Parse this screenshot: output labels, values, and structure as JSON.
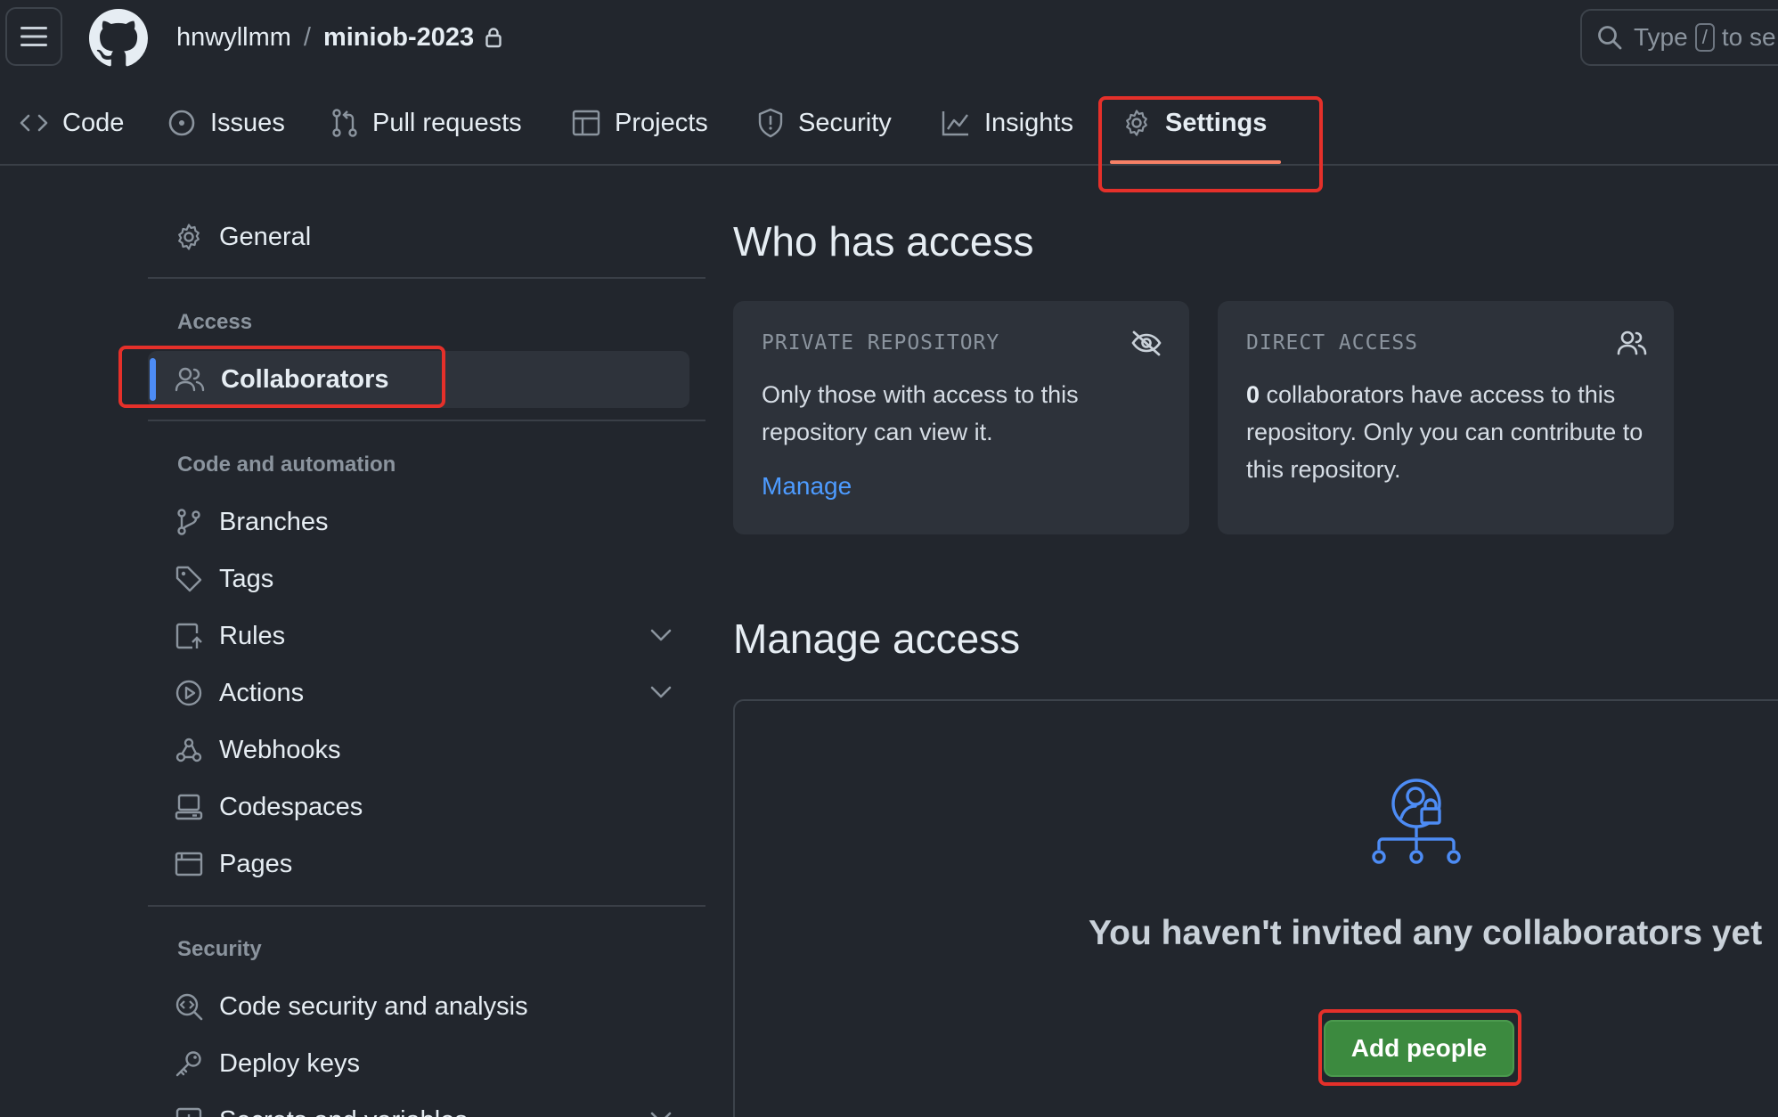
{
  "header": {
    "owner": "hnwyllmm",
    "separator": "/",
    "repo": "miniob-2023",
    "search": {
      "prefix": "Type",
      "key": "/",
      "suffix": "to se"
    },
    "tabs": [
      {
        "label": "Code",
        "icon": "code-icon"
      },
      {
        "label": "Issues",
        "icon": "issue-icon"
      },
      {
        "label": "Pull requests",
        "icon": "pull-request-icon"
      },
      {
        "label": "Projects",
        "icon": "table-icon"
      },
      {
        "label": "Security",
        "icon": "shield-icon"
      },
      {
        "label": "Insights",
        "icon": "graph-icon"
      },
      {
        "label": "Settings",
        "icon": "gear-icon",
        "active": true
      }
    ]
  },
  "sidebar": {
    "general": "General",
    "sections": [
      {
        "heading": "Access",
        "items": [
          {
            "label": "Collaborators",
            "icon": "people-icon",
            "selected": true
          }
        ]
      },
      {
        "heading": "Code and automation",
        "items": [
          {
            "label": "Branches",
            "icon": "branch-icon"
          },
          {
            "label": "Tags",
            "icon": "tag-icon"
          },
          {
            "label": "Rules",
            "icon": "rules-icon",
            "expandable": true
          },
          {
            "label": "Actions",
            "icon": "play-icon",
            "expandable": true
          },
          {
            "label": "Webhooks",
            "icon": "webhook-icon"
          },
          {
            "label": "Codespaces",
            "icon": "codespaces-icon"
          },
          {
            "label": "Pages",
            "icon": "browser-icon"
          }
        ]
      },
      {
        "heading": "Security",
        "items": [
          {
            "label": "Code security and analysis",
            "icon": "codescan-icon"
          },
          {
            "label": "Deploy keys",
            "icon": "key-icon"
          },
          {
            "label": "Secrets and variables",
            "icon": "secret-icon",
            "expandable": true
          }
        ]
      }
    ]
  },
  "main": {
    "who_title": "Who has access",
    "private_card": {
      "label": "PRIVATE REPOSITORY",
      "desc": "Only those with access to this repository can view it.",
      "link": "Manage",
      "icon": "eye-closed-icon"
    },
    "direct_card": {
      "label": "DIRECT ACCESS",
      "count": "0",
      "desc": " collaborators have access to this repository. Only you can contribute to this repository.",
      "icon": "people-icon"
    },
    "manage_title": "Manage access",
    "empty_title": "You haven't invited any collaborators yet",
    "add_button": "Add people"
  },
  "colors": {
    "background": "#22262d",
    "accent_underline": "#f78166",
    "link": "#4d9bff",
    "primary_button": "#3c8a3f",
    "highlight": "#e5302a"
  }
}
